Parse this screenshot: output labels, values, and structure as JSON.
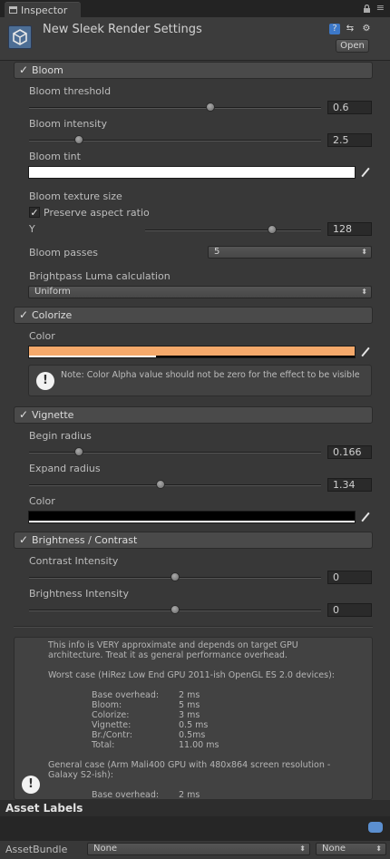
{
  "tab": {
    "label": "Inspector"
  },
  "header": {
    "title": "New Sleek Render Settings",
    "open_button": "Open"
  },
  "bloom": {
    "section_label": "Bloom",
    "enabled": true,
    "threshold": {
      "label": "Bloom threshold",
      "value": "0.6",
      "fraction": 0.62
    },
    "intensity": {
      "label": "Bloom intensity",
      "value": "2.5",
      "fraction": 0.17
    },
    "tint": {
      "label": "Bloom tint",
      "color": "#ffffff"
    },
    "texture_size_label": "Bloom texture size",
    "preserve_aspect": {
      "label": "Preserve aspect ratio",
      "checked": true
    },
    "y": {
      "label": "Y",
      "value": "128",
      "fraction": 0.72
    },
    "passes": {
      "label": "Bloom passes",
      "value": "5"
    },
    "brightpass": {
      "label": "Brightpass Luma calculation",
      "value": "Uniform"
    }
  },
  "colorize": {
    "section_label": "Colorize",
    "enabled": true,
    "color_label": "Color",
    "color": "#f5a96b",
    "note": "Note: Color Alpha value should not be zero for the effect to be visible"
  },
  "vignette": {
    "section_label": "Vignette",
    "enabled": true,
    "begin": {
      "label": "Begin radius",
      "value": "0.166",
      "fraction": 0.17
    },
    "expand": {
      "label": "Expand radius",
      "value": "1.34",
      "fraction": 0.45
    },
    "color_label": "Color",
    "color": "#000000"
  },
  "brightness_contrast": {
    "section_label": "Brightness / Contrast",
    "enabled": true,
    "contrast": {
      "label": "Contrast Intensity",
      "value": "0",
      "fraction": 0.5
    },
    "brightness": {
      "label": "Brightness Intensity",
      "value": "0",
      "fraction": 0.5
    }
  },
  "info": {
    "intro": "This info is VERY approximate and depends on target GPU\narchitecture. Treat it as general performance overhead.",
    "worst_case": "Worst case (HiRez Low End GPU 2011-ish OpenGL ES 2.0 devices):",
    "worst_rows": [
      {
        "k": "Base overhead:",
        "v": "2 ms"
      },
      {
        "k": "Bloom:",
        "v": "5 ms"
      },
      {
        "k": "Colorize:",
        "v": "3 ms"
      },
      {
        "k": "Vignette:",
        "v": "0.5 ms"
      },
      {
        "k": "Br./Contr:",
        "v": "0.5ms"
      },
      {
        "k": "Total:",
        "v": "11.00 ms"
      }
    ],
    "general_case": "General case (Arm Mali400 GPU with 480x864 screen resolution -\nGalaxy S2-ish):",
    "general_rows": [
      {
        "k": "Base overhead:",
        "v": "2 ms"
      }
    ]
  },
  "asset_labels": {
    "title": "Asset Labels"
  },
  "asset_bundle": {
    "label": "AssetBundle",
    "value": "None",
    "variant": "None"
  }
}
